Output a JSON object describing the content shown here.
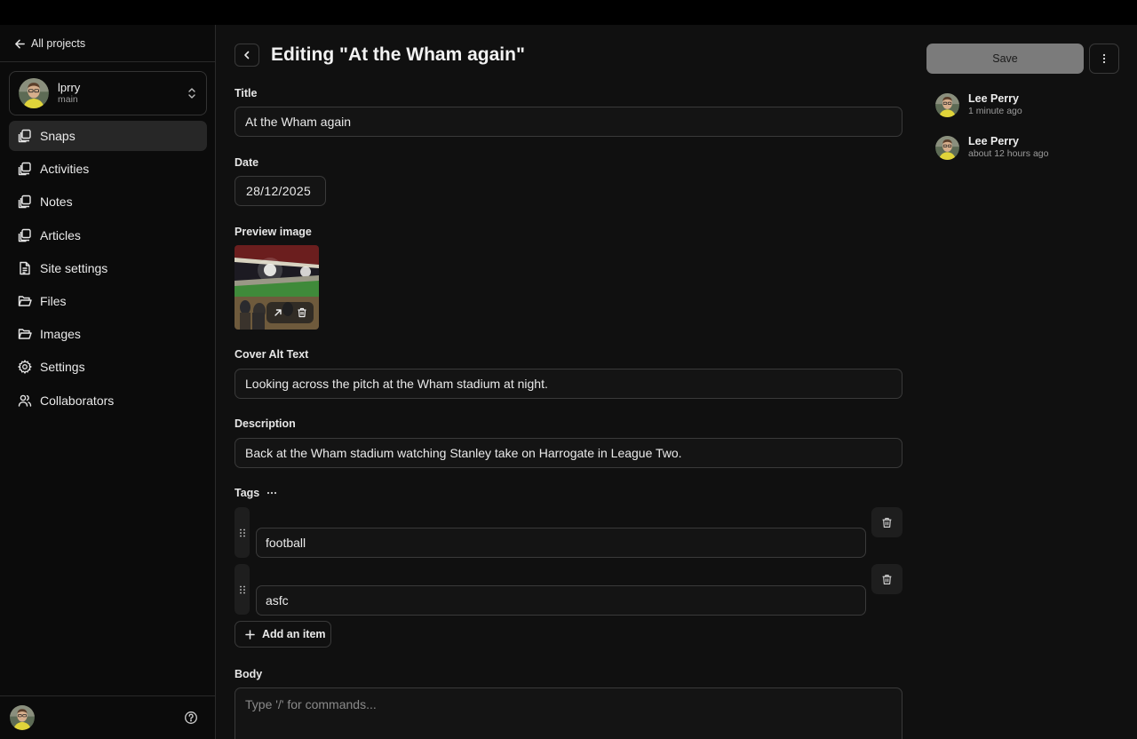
{
  "sidebar": {
    "back_label": "All projects",
    "project": {
      "name": "lprry",
      "branch": "main"
    },
    "items": [
      {
        "label": "Snaps",
        "icon": "collection-icon",
        "active": true
      },
      {
        "label": "Activities",
        "icon": "collection-icon",
        "active": false
      },
      {
        "label": "Notes",
        "icon": "collection-icon",
        "active": false
      },
      {
        "label": "Articles",
        "icon": "collection-icon",
        "active": false
      },
      {
        "label": "Site settings",
        "icon": "file-icon",
        "active": false
      },
      {
        "label": "Files",
        "icon": "folder-icon",
        "active": false
      },
      {
        "label": "Images",
        "icon": "folder-icon",
        "active": false
      },
      {
        "label": "Settings",
        "icon": "gear-icon",
        "active": false
      },
      {
        "label": "Collaborators",
        "icon": "users-icon",
        "active": false
      }
    ]
  },
  "editor": {
    "title": "Editing \"At the Wham again\"",
    "fields": {
      "title_label": "Title",
      "title_value": "At the Wham again",
      "date_label": "Date",
      "date_value": "28/12/2025",
      "preview_label": "Preview image",
      "alt_label": "Cover Alt Text",
      "alt_value": "Looking across the pitch at the Wham stadium at night.",
      "description_label": "Description",
      "description_value": "Back at the Wham stadium watching Stanley take on Harrogate in League Two.",
      "tags_label": "Tags",
      "tags": [
        "football",
        "asfc"
      ],
      "add_item_label": "Add an item",
      "body_label": "Body",
      "body_placeholder": "Type '/' for commands..."
    }
  },
  "actions": {
    "save_label": "Save"
  },
  "revisions": [
    {
      "name": "Lee Perry",
      "time": "1 minute ago"
    },
    {
      "name": "Lee Perry",
      "time": "about 12 hours ago"
    }
  ],
  "colors": {
    "background": "#101010",
    "save_button": "#7b7b7b",
    "active_nav": "#272727"
  }
}
